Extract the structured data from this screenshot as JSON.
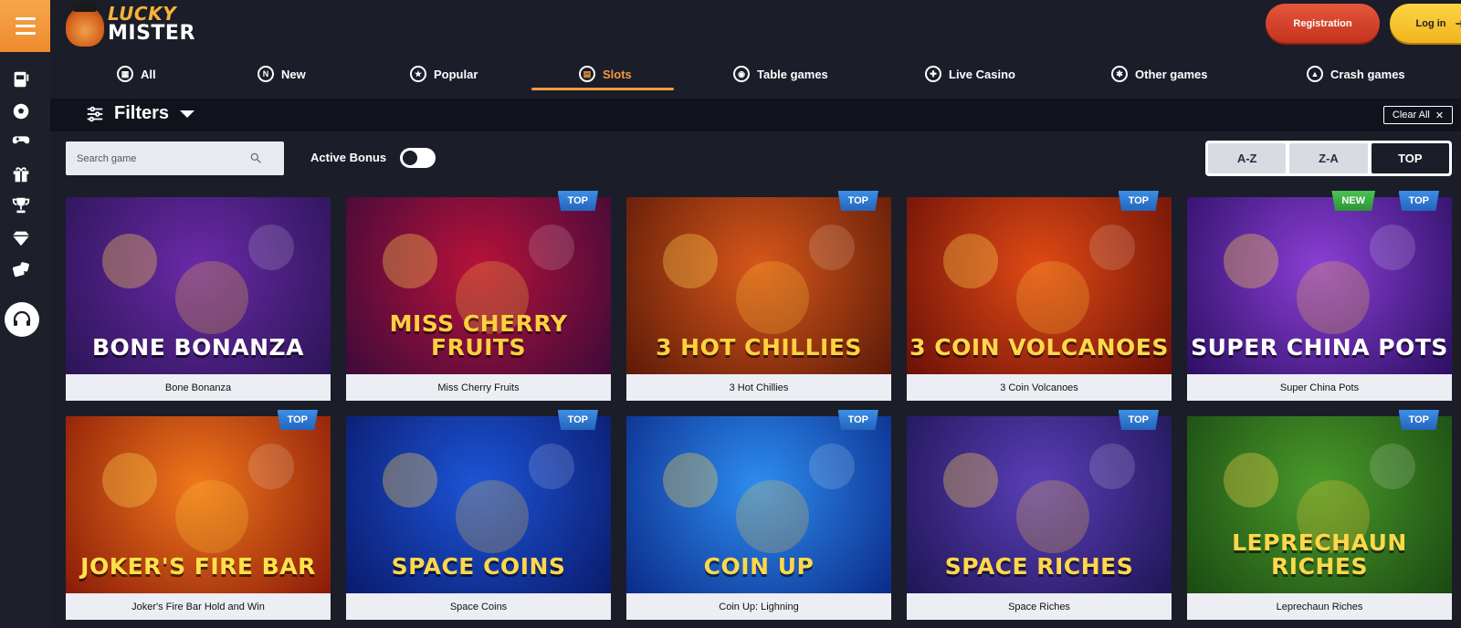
{
  "brand": {
    "line1": "LUCKY",
    "line2": "MISTER"
  },
  "auth": {
    "register": "Registration",
    "login": "Log in"
  },
  "categories": [
    {
      "label": "All",
      "icon": "grid-icon",
      "glyph": "▦",
      "active": false
    },
    {
      "label": "New",
      "icon": "new-icon",
      "glyph": "N",
      "active": false
    },
    {
      "label": "Popular",
      "icon": "popular-icon",
      "glyph": "★",
      "active": false
    },
    {
      "label": "Slots",
      "icon": "slots-icon",
      "glyph": "▤",
      "active": true
    },
    {
      "label": "Table games",
      "icon": "table-games-icon",
      "glyph": "◉",
      "active": false
    },
    {
      "label": "Live Casino",
      "icon": "live-casino-icon",
      "glyph": "✚",
      "active": false
    },
    {
      "label": "Other games",
      "icon": "other-games-icon",
      "glyph": "✱",
      "active": false
    },
    {
      "label": "Crash games",
      "icon": "crash-games-icon",
      "glyph": "▲",
      "active": false
    }
  ],
  "filters": {
    "title": "Filters",
    "clear_all": "Clear All"
  },
  "search": {
    "placeholder": "Search game"
  },
  "active_bonus": {
    "label": "Active Bonus",
    "on": false
  },
  "sort": {
    "options": [
      "A-Z",
      "Z-A",
      "TOP"
    ],
    "selected": "TOP"
  },
  "games": [
    {
      "title": "Bone Bonanza",
      "art": "BONE BONANZA",
      "badges": [],
      "bg": [
        "#6a2aa8",
        "#2b1455"
      ],
      "text": "#ffffff"
    },
    {
      "title": "Miss Cherry Fruits",
      "art": "MISS CHERRY FRUITS",
      "badges": [
        "TOP"
      ],
      "bg": [
        "#b8123a",
        "#3d0a3a"
      ],
      "text": "#ffcf3d"
    },
    {
      "title": "3 Hot Chillies",
      "art": "3 HOT CHILLIES",
      "badges": [
        "TOP"
      ],
      "bg": [
        "#d8571a",
        "#5c1a08"
      ],
      "text": "#ffd23d"
    },
    {
      "title": "3 Coin Volcanoes",
      "art": "3 COIN VOLCANOES",
      "badges": [
        "TOP"
      ],
      "bg": [
        "#e04a14",
        "#6b1008"
      ],
      "text": "#ffd84a"
    },
    {
      "title": "Super China Pots",
      "art": "SUPER CHINA POTS",
      "badges": [
        "NEW",
        "TOP"
      ],
      "bg": [
        "#8b3fd6",
        "#2c0f63"
      ],
      "text": "#ffffff"
    },
    {
      "title": "Joker's Fire Bar Hold and Win",
      "art": "JOKER'S FIRE BAR",
      "badges": [
        "TOP"
      ],
      "bg": [
        "#f0781c",
        "#8a1a08"
      ],
      "text": "#ffe04a"
    },
    {
      "title": "Space Coins",
      "art": "SPACE COINS",
      "badges": [
        "TOP"
      ],
      "bg": [
        "#1d55d8",
        "#0a1a6b"
      ],
      "text": "#ffd84a"
    },
    {
      "title": "Coin Up: Lighning",
      "art": "COIN UP",
      "badges": [
        "TOP"
      ],
      "bg": [
        "#2d8ef0",
        "#0b2a8a"
      ],
      "text": "#ffd84a"
    },
    {
      "title": "Space Riches",
      "art": "SPACE RICHES",
      "badges": [
        "TOP"
      ],
      "bg": [
        "#5a3fb8",
        "#1f1555"
      ],
      "text": "#ffd84a"
    },
    {
      "title": "Leprechaun Riches",
      "art": "LEPRECHAUN RICHES",
      "badges": [
        "TOP"
      ],
      "bg": [
        "#4a9a2a",
        "#1a4a12"
      ],
      "text": "#ffd84a"
    }
  ],
  "rail_icons": [
    "slot-machine-icon",
    "soccer-ball-icon",
    "gamepad-icon",
    "gift-icon",
    "trophy-icon",
    "diamond-icon",
    "dice-icon",
    "support-icon"
  ]
}
